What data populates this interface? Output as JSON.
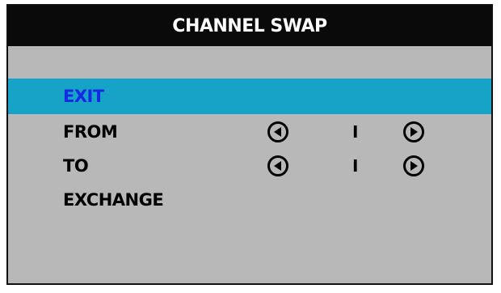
{
  "menu": {
    "title": "CHANNEL SWAP",
    "items": [
      {
        "label": "EXIT",
        "selected": true
      },
      {
        "label": "FROM",
        "value": "I"
      },
      {
        "label": "TO",
        "value": "I"
      },
      {
        "label": "EXCHANGE"
      }
    ]
  },
  "colors": {
    "title_bg": "#0a0a0a",
    "title_text": "#ffffff",
    "menu_bg": "#b8b8b8",
    "highlight_bg": "#17a3c8",
    "selected_text": "#1428e6",
    "text": "#000000"
  },
  "icons": {
    "decrease": "arrow-left-circle-icon",
    "increase": "arrow-right-circle-icon"
  }
}
